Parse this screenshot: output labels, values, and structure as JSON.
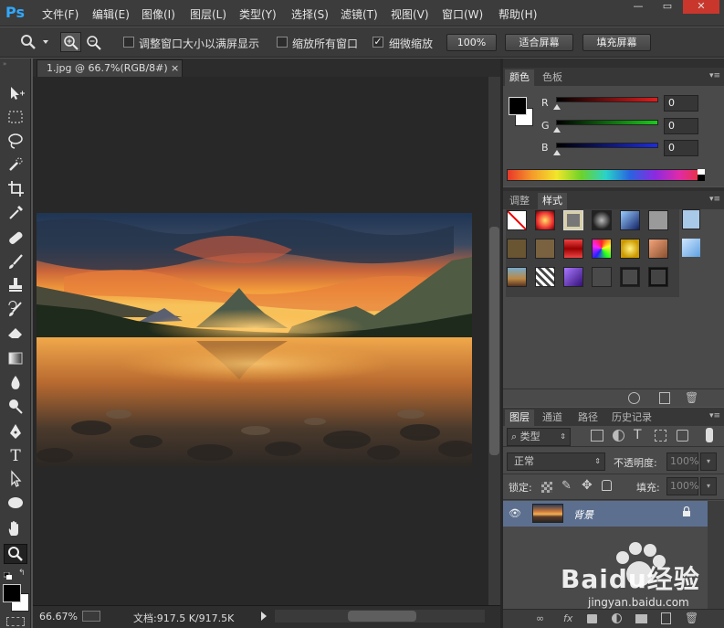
{
  "app": {
    "logo": "Ps",
    "accent": "#31a8ff"
  },
  "menu": [
    "文件(F)",
    "编辑(E)",
    "图像(I)",
    "图层(L)",
    "类型(Y)",
    "选择(S)",
    "滤镜(T)",
    "视图(V)",
    "窗口(W)",
    "帮助(H)"
  ],
  "window_controls": {
    "minimize": "—",
    "restore": "▭",
    "close": "✕"
  },
  "options": {
    "resize_windows": "调整窗口大小以满屏显示",
    "zoom_all": "缩放所有窗口",
    "scrubby_zoom": "细微缩放",
    "btn_100": "100%",
    "btn_fit": "适合屏幕",
    "btn_fill": "填充屏幕"
  },
  "document": {
    "tab_title": "1.jpg @ 66.7%(RGB/8#)",
    "close": "×",
    "zoom": "66.67%",
    "doc_info": "文档:917.5 K/917.5K"
  },
  "color_panel": {
    "tabs": [
      "颜色",
      "色板"
    ],
    "channels": [
      {
        "label": "R",
        "value": "0",
        "color": "#d02020"
      },
      {
        "label": "G",
        "value": "0",
        "color": "#20b020"
      },
      {
        "label": "B",
        "value": "0",
        "color": "#2030d0"
      }
    ]
  },
  "styles_panel": {
    "tabs": [
      "调整",
      "样式"
    ]
  },
  "layers_panel": {
    "tabs": [
      "图层",
      "通道",
      "路径",
      "历史记录"
    ],
    "filter_kind": "类型",
    "blend_mode": "正常",
    "opacity_label": "不透明度:",
    "opacity_value": "100%",
    "lock_label": "锁定:",
    "fill_label": "填充:",
    "fill_value": "100%",
    "layer_name": "背景"
  },
  "watermark": {
    "brand": "Baidu经验",
    "url": "jingyan.baidu.com"
  }
}
